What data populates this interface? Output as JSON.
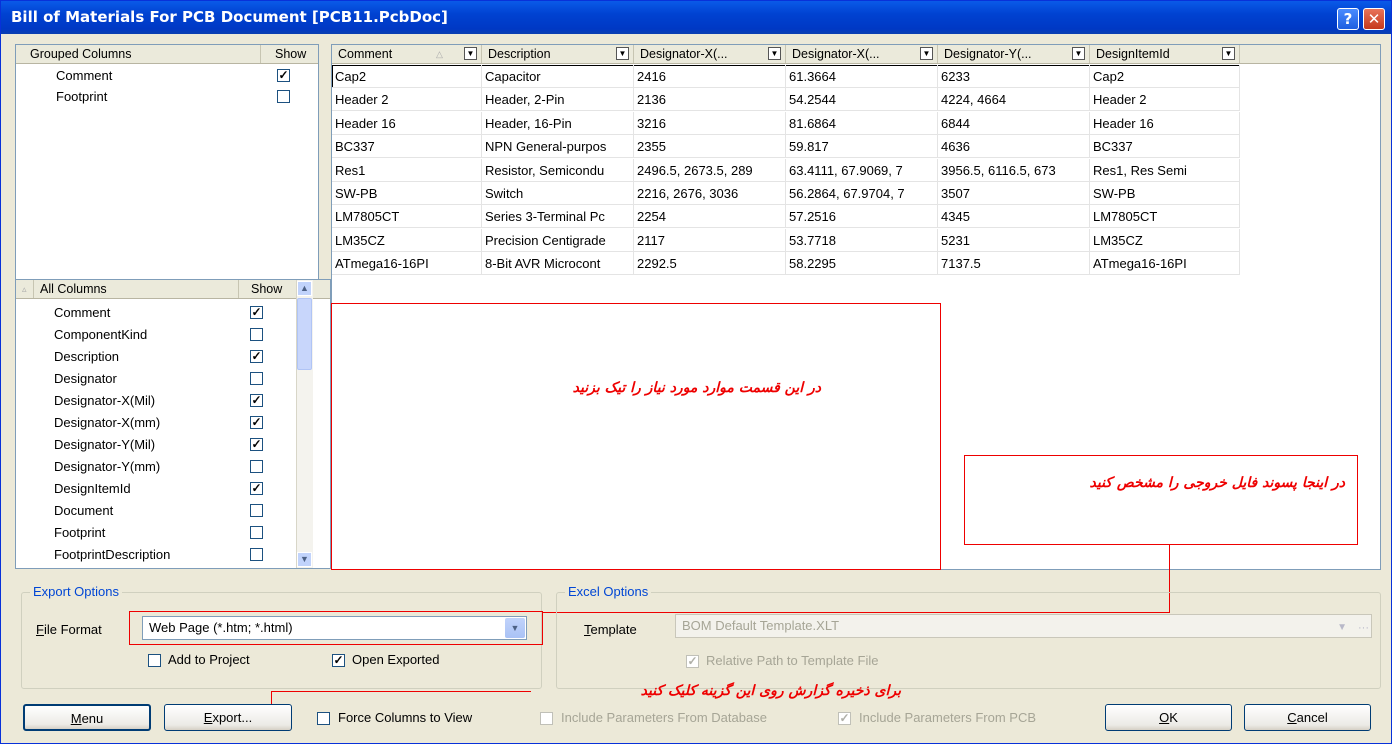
{
  "window": {
    "title": "Bill of Materials For PCB Document [PCB11.PcbDoc]",
    "help": "?",
    "close": "✕"
  },
  "grouped": {
    "header_name": "Grouped Columns",
    "header_show": "Show",
    "rows": [
      {
        "name": "Comment",
        "checked": true
      },
      {
        "name": "Footprint",
        "checked": false
      }
    ]
  },
  "allcols": {
    "header_name": "All Columns",
    "header_show": "Show",
    "rows": [
      {
        "name": "Comment",
        "checked": true
      },
      {
        "name": "ComponentKind",
        "checked": false
      },
      {
        "name": "Description",
        "checked": true
      },
      {
        "name": "Designator",
        "checked": false
      },
      {
        "name": "Designator-X(Mil)",
        "checked": true
      },
      {
        "name": "Designator-X(mm)",
        "checked": true
      },
      {
        "name": "Designator-Y(Mil)",
        "checked": true
      },
      {
        "name": "Designator-Y(mm)",
        "checked": false
      },
      {
        "name": "DesignItemId",
        "checked": true
      },
      {
        "name": "Document",
        "checked": false
      },
      {
        "name": "Footprint",
        "checked": false
      },
      {
        "name": "FootprintDescription",
        "checked": false
      }
    ]
  },
  "grid": {
    "columns": [
      "Comment",
      "Description",
      "Designator-X(...",
      "Designator-X(...",
      "Designator-Y(...",
      "DesignItemId"
    ],
    "rows": [
      [
        "Cap2",
        "Capacitor",
        "2416",
        "61.3664",
        "6233",
        "Cap2"
      ],
      [
        "Header 2",
        "Header, 2-Pin",
        "2136",
        "54.2544",
        "4224, 4664",
        "Header 2"
      ],
      [
        "Header 16",
        "Header, 16-Pin",
        "3216",
        "81.6864",
        "6844",
        "Header 16"
      ],
      [
        "BC337",
        "NPN General-purpos",
        "2355",
        "59.817",
        "4636",
        "BC337"
      ],
      [
        "Res1",
        "Resistor, Semicondu",
        "2496.5, 2673.5, 289",
        "63.4111, 67.9069, 7",
        "3956.5, 6116.5, 673",
        "Res1, Res Semi"
      ],
      [
        "SW-PB",
        "Switch",
        "2216, 2676, 3036",
        "56.2864, 67.9704, 7",
        "3507",
        "SW-PB"
      ],
      [
        "LM7805CT",
        "Series 3-Terminal Pc",
        "2254",
        "57.2516",
        "4345",
        "LM7805CT"
      ],
      [
        "LM35CZ",
        "Precision Centigrade",
        "2117",
        "53.7718",
        "5231",
        "LM35CZ"
      ],
      [
        "ATmega16-16PI",
        "8-Bit AVR Microcont",
        "2292.5",
        "58.2295",
        "7137.5",
        "ATmega16-16PI"
      ]
    ]
  },
  "notes": {
    "select": "در این قسمت موارد مورد نیاز را تیک بزنید",
    "format": "در اینجا پسوند فایل خروجی را مشخص کنید",
    "export": "برای ذخیره گزارش روی این گزینه کلیک کنید"
  },
  "export_options": {
    "legend": "Export Options",
    "file_format_label": "File Format",
    "file_format_value": "Web Page (*.htm; *.html)",
    "add_to_project": "Add to Project",
    "add_to_project_checked": false,
    "open_exported": "Open Exported",
    "open_exported_checked": true
  },
  "excel_options": {
    "legend": "Excel Options",
    "template_label": "Template",
    "template_value": "BOM Default Template.XLT",
    "relative_path": "Relative Path to Template File",
    "relative_path_checked": true
  },
  "bottom": {
    "menu": "Menu",
    "export": "Export...",
    "force_columns": "Force Columns to View",
    "include_db": "Include Parameters From Database",
    "include_pcb": "Include Parameters From PCB",
    "ok": "OK",
    "cancel": "Cancel"
  },
  "colors": {
    "title_blue": "#0042d1",
    "annotation_red": "#e00000",
    "legend_blue": "#0046d5"
  }
}
